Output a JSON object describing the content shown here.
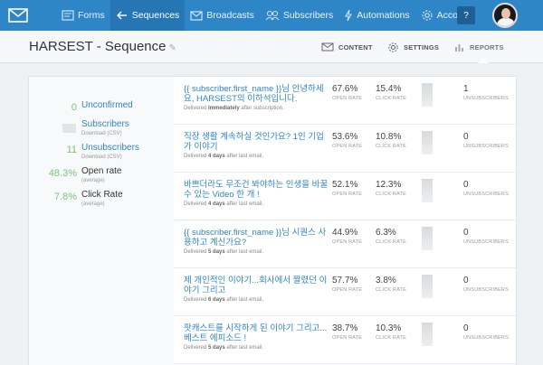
{
  "nav": {
    "items": [
      {
        "id": "forms",
        "label": "Forms",
        "icon": "forms-icon"
      },
      {
        "id": "sequences",
        "label": "Sequences",
        "icon": "sequences-icon"
      },
      {
        "id": "broadcasts",
        "label": "Broadcasts",
        "icon": "envelope-icon"
      },
      {
        "id": "subscribers",
        "label": "Subscribers",
        "icon": "users-icon"
      },
      {
        "id": "automations",
        "label": "Automations",
        "icon": "lightning-icon"
      },
      {
        "id": "account",
        "label": "Account",
        "icon": "gear-icon"
      }
    ],
    "help_label": "?",
    "active": "sequences",
    "accent": "#2f86c6"
  },
  "header": {
    "title": "HARSEST - Sequence",
    "tabs": {
      "content": "CONTENT",
      "settings": "SETTINGS",
      "reports": "REPORTS"
    },
    "active_tab": "reports"
  },
  "stats": [
    {
      "value": "0",
      "label": "Unconfirmed",
      "sub": "",
      "link": true
    },
    {
      "value": "",
      "label": "Subscribers",
      "sub": "Download (CSV)",
      "link": true
    },
    {
      "value": "11",
      "label": "Unsubscribers",
      "sub": "Download (CSV)",
      "link": true
    },
    {
      "value": "48.3%",
      "label": "Open rate",
      "sub": "(average)",
      "link": false
    },
    {
      "value": "7.8%",
      "label": "Click Rate",
      "sub": "(average)",
      "link": false
    }
  ],
  "emails": [
    {
      "title": "{{ subscriber.first_name }}님 안녕하세요, HARSEST의 이하석입니다.",
      "delivered_prefix": "Delivered",
      "delivered_when": "Immediately",
      "delivered_suffix": "after subscription.",
      "open_rate": "67.6%",
      "click_rate": "15.4%",
      "unsubscribers": "1"
    },
    {
      "title": "직장 생활 계속하실 것인가요? 1인 기업가 이야기",
      "delivered_prefix": "Delivered",
      "delivered_when": "4 days",
      "delivered_suffix": "after last email.",
      "open_rate": "53.6%",
      "click_rate": "10.8%",
      "unsubscribers": "0"
    },
    {
      "title": "바쁘더라도 무조건 봐야하는 인생을 바꿀 수 있는 Video 한 개 !",
      "delivered_prefix": "Delivered",
      "delivered_when": "4 days",
      "delivered_suffix": "after last email.",
      "open_rate": "52.1%",
      "click_rate": "12.3%",
      "unsubscribers": "0"
    },
    {
      "title": "{{ subscriber.first_name }}님 시퀀스 사용하고 계신가요?",
      "delivered_prefix": "Delivered",
      "delivered_when": "5 days",
      "delivered_suffix": "after last email.",
      "open_rate": "44.9%",
      "click_rate": "6.3%",
      "unsubscribers": "0"
    },
    {
      "title": "제 개인적인 이야기...회사에서 짤렸던 이야기 그리고",
      "delivered_prefix": "Delivered",
      "delivered_when": "6 days",
      "delivered_suffix": "after last email.",
      "open_rate": "57.7%",
      "click_rate": "3.8%",
      "unsubscribers": "0"
    },
    {
      "title": "팟캐스트를 시작하게 된 이야기 그리고... 베스트 에피소드 !",
      "delivered_prefix": "Delivered",
      "delivered_when": "5 days",
      "delivered_suffix": "after last email.",
      "open_rate": "38.7%",
      "click_rate": "10.3%",
      "unsubscribers": "0"
    }
  ],
  "metric_labels": {
    "open": "OPEN RATE",
    "click": "CLICK RATE",
    "unsub": "UNSUBSCRIBERS"
  }
}
